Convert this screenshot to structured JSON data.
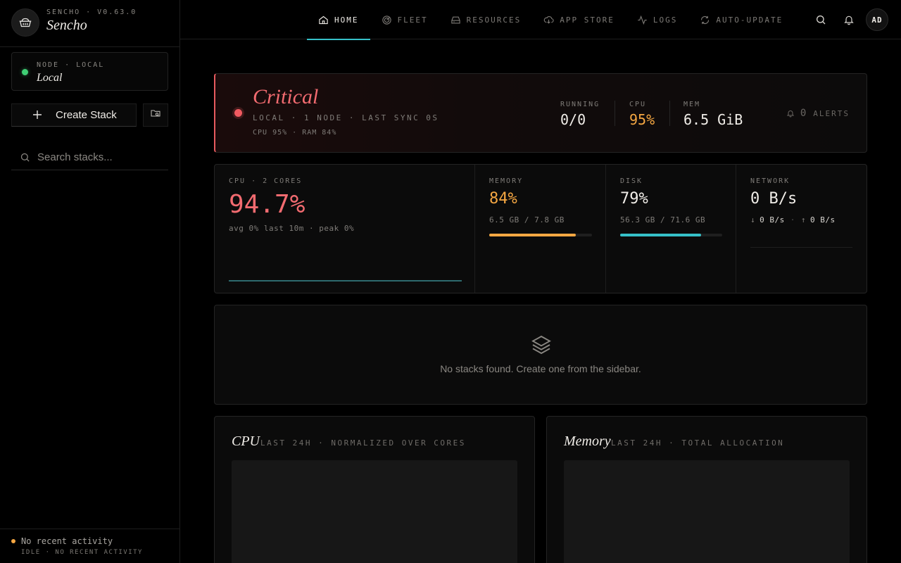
{
  "brand": {
    "version": "SENCHO · V0.63.0",
    "name": "Sencho"
  },
  "node": {
    "label": "NODE · LOCAL",
    "name": "Local",
    "status_color": "#3fce74"
  },
  "sidebar": {
    "create_label": "Create Stack",
    "search_placeholder": "Search stacks...",
    "footer_main": "No recent activity",
    "footer_sub": "IDLE · NO RECENT ACTIVITY"
  },
  "nav": {
    "items": [
      {
        "label": "HOME",
        "icon": "home-icon"
      },
      {
        "label": "FLEET",
        "icon": "radar-icon"
      },
      {
        "label": "RESOURCES",
        "icon": "drive-icon"
      },
      {
        "label": "APP STORE",
        "icon": "cloud-download-icon"
      },
      {
        "label": "LOGS",
        "icon": "activity-icon"
      },
      {
        "label": "AUTO-UPDATE",
        "icon": "refresh-icon"
      }
    ],
    "active": "HOME",
    "avatar": "AD"
  },
  "status": {
    "title": "Critical",
    "meta": "LOCAL · 1 NODE · LAST SYNC 0S",
    "sub": "CPU 95% · RAM 84%",
    "running_label": "RUNNING",
    "running_value": "0/0",
    "cpu_label": "CPU",
    "cpu_value": "95%",
    "mem_label": "MEM",
    "mem_value": "6.5 GiB",
    "alerts_count": "0",
    "alerts_label": "ALERTS",
    "color": "#e75a5e"
  },
  "metrics": {
    "cpu": {
      "label": "CPU · 2 CORES",
      "value": "94.7%",
      "sub": "avg 0% last 10m · peak 0%",
      "color": "#f26b70"
    },
    "memory": {
      "label": "MEMORY",
      "value": "84%",
      "sub": "6.5 GB / 7.8 GB",
      "percent": 84,
      "color": "#f5a742"
    },
    "disk": {
      "label": "DISK",
      "value": "79%",
      "sub": "56.3 GB / 71.6 GB",
      "percent": 79,
      "color": "#36c0c8"
    },
    "network": {
      "label": "NETWORK",
      "value": "0 B/s",
      "down": "0 B/s",
      "up": "0 B/s"
    }
  },
  "empty": {
    "text": "No stacks found. Create one from the sidebar."
  },
  "charts": {
    "cpu": {
      "title": "CPU",
      "sub": "LAST 24H · NORMALIZED OVER CORES"
    },
    "memory": {
      "title": "Memory",
      "sub": "LAST 24H · TOTAL ALLOCATION"
    }
  }
}
